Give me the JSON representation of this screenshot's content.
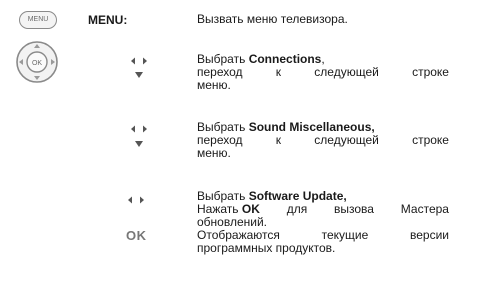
{
  "remote": {
    "menu_button_label": "MENU",
    "ok_label": "OK"
  },
  "menu_key": "MENU:",
  "intro": "Вызвать меню телевизора.",
  "steps": [
    {
      "verb": "Выбрать",
      "bold": "Connections",
      "tail": ",",
      "line2": [
        "переход",
        "к",
        "следующей",
        "строке"
      ],
      "line3": "меню."
    },
    {
      "verb": "Выбрать",
      "bold": "Sound Miscellaneous,",
      "tail": "",
      "line2": [
        "переход",
        "к",
        "следующей",
        "строке"
      ],
      "line3": "меню."
    },
    {
      "verb": "Выбрать",
      "bold": "Software Update,",
      "press_verb": "Нажать",
      "ok_bold": "OK",
      "press_tail": [
        "для",
        "вызова",
        "Мастера"
      ],
      "press_line2": "обновлений.",
      "shown_line1": [
        "Отображаются",
        "текущие",
        "версии"
      ],
      "shown_line2": "программных продуктов."
    }
  ],
  "ok_key": "OK"
}
